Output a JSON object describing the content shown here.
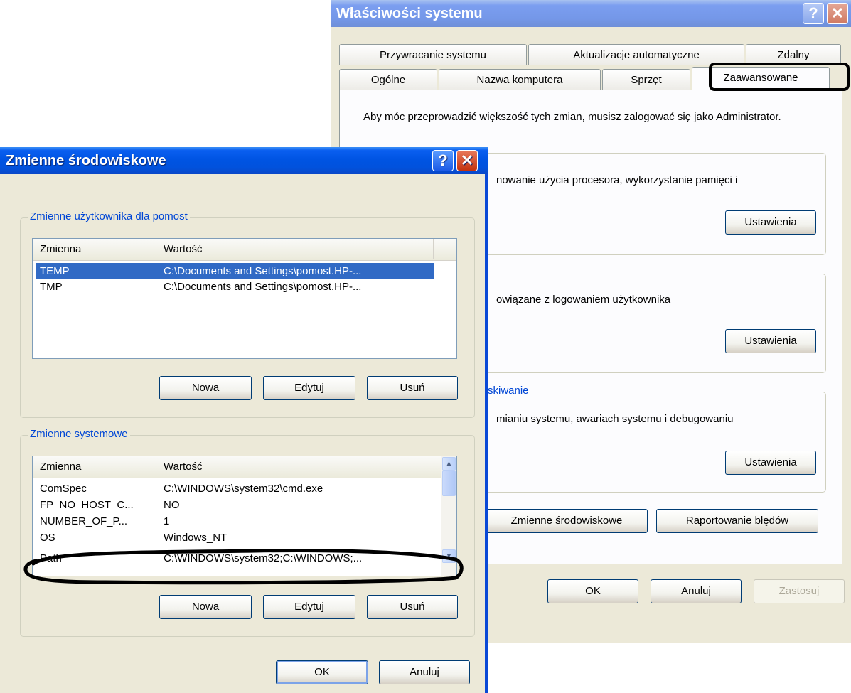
{
  "system_properties": {
    "title": "Właściwości systemu",
    "help_glyph": "?",
    "close_glyph": "✕",
    "tabs_back": [
      "Przywracanie systemu",
      "Aktualizacje automatyczne",
      "Zdalny"
    ],
    "tabs_front": [
      "Ogólne",
      "Nazwa komputera",
      "Sprzęt",
      "Zaawansowane"
    ],
    "active_tab": "Zaawansowane",
    "admin_note": "Aby móc przeprowadzić większość tych zmian, musisz zalogować się jako Administrator.",
    "performance_text": "nowanie użycia procesora, wykorzystanie pamięci i",
    "profile_text": "owiązane z logowaniem użytkownika",
    "startup_legend": "skiwanie",
    "startup_text": "mianiu systemu, awariach systemu i debugowaniu",
    "settings_label": "Ustawienia",
    "env_vars_button": "Zmienne środowiskowe",
    "error_report_button": "Raportowanie błędów",
    "ok": "OK",
    "cancel": "Anuluj",
    "apply": "Zastosuj"
  },
  "env_dialog": {
    "title": "Zmienne środowiskowe",
    "help_glyph": "?",
    "close_glyph": "✕",
    "user_group_label": "Zmienne użytkownika dla pomost",
    "system_group_label": "Zmienne systemowe",
    "col_name": "Zmienna",
    "col_value": "Wartość",
    "user_vars": [
      {
        "name": "TEMP",
        "value": "C:\\Documents and Settings\\pomost.HP-..."
      },
      {
        "name": "TMP",
        "value": "C:\\Documents and Settings\\pomost.HP-..."
      }
    ],
    "system_vars": [
      {
        "name": "ComSpec",
        "value": "C:\\WINDOWS\\system32\\cmd.exe"
      },
      {
        "name": "FP_NO_HOST_C...",
        "value": "NO"
      },
      {
        "name": "NUMBER_OF_P...",
        "value": "1"
      },
      {
        "name": "OS",
        "value": "Windows_NT"
      },
      {
        "name": "Path",
        "value": "C:\\WINDOWS\\system32;C:\\WINDOWS;..."
      }
    ],
    "new_label": "Nowa",
    "edit_label": "Edytuj",
    "delete_label": "Usuń",
    "ok": "OK",
    "cancel": "Anuluj"
  },
  "scroll_glyphs": {
    "up": "▲",
    "down": "▼"
  },
  "colors": {
    "titlebar": "#0054e3",
    "selection": "#316ac5",
    "annotation": "#000000"
  }
}
